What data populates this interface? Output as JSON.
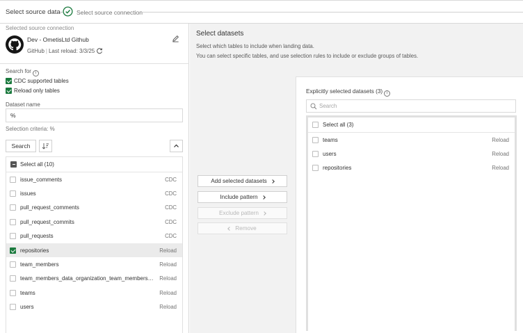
{
  "stepper": {
    "step1": "Select source data",
    "step2": "Select source connection"
  },
  "source": {
    "label": "Selected source connection",
    "name": "Dev - OmetisLtd Github",
    "type": "GitHub",
    "last_reload": "Last reload: 3/3/25"
  },
  "filters": {
    "search_for": "Search for",
    "cdc_label": "CDC supported tables",
    "cdc_checked": true,
    "reload_label": "Reload only tables",
    "reload_checked": true,
    "dataset_name_label": "Dataset name",
    "dataset_name_value": "%",
    "selection_criteria": "Selection criteria: %",
    "search_button": "Search"
  },
  "left_list": {
    "select_all": "Select all (10)",
    "items": [
      {
        "name": "issue_comments",
        "type": "CDC",
        "checked": false
      },
      {
        "name": "issues",
        "type": "CDC",
        "checked": false
      },
      {
        "name": "pull_request_comments",
        "type": "CDC",
        "checked": false
      },
      {
        "name": "pull_request_commits",
        "type": "CDC",
        "checked": false
      },
      {
        "name": "pull_requests",
        "type": "CDC",
        "checked": false
      },
      {
        "name": "repositories",
        "type": "Reload",
        "checked": true
      },
      {
        "name": "team_members",
        "type": "Reload",
        "checked": false
      },
      {
        "name": "team_members_data_organization_team_members_...",
        "type": "Reload",
        "checked": false
      },
      {
        "name": "teams",
        "type": "Reload",
        "checked": false
      },
      {
        "name": "users",
        "type": "Reload",
        "checked": false
      }
    ]
  },
  "main": {
    "title": "Select datasets",
    "desc1": "Select which tables to include when landing data.",
    "desc2": "You can select specific tables, and use selection rules to include or exclude groups of tables.",
    "buttons": {
      "add_selected": "Add selected datasets",
      "include_pattern": "Include pattern",
      "exclude_pattern": "Exclude pattern",
      "remove": "Remove"
    }
  },
  "right": {
    "title": "Explicitly selected datasets (3)",
    "search_placeholder": "Search",
    "select_all": "Select all (3)",
    "items": [
      {
        "name": "teams",
        "type": "Reload"
      },
      {
        "name": "users",
        "type": "Reload"
      },
      {
        "name": "repositories",
        "type": "Reload"
      }
    ]
  },
  "colors": {
    "accent_green": "#1b7a3e",
    "panel_bg": "#f2f2f2"
  }
}
